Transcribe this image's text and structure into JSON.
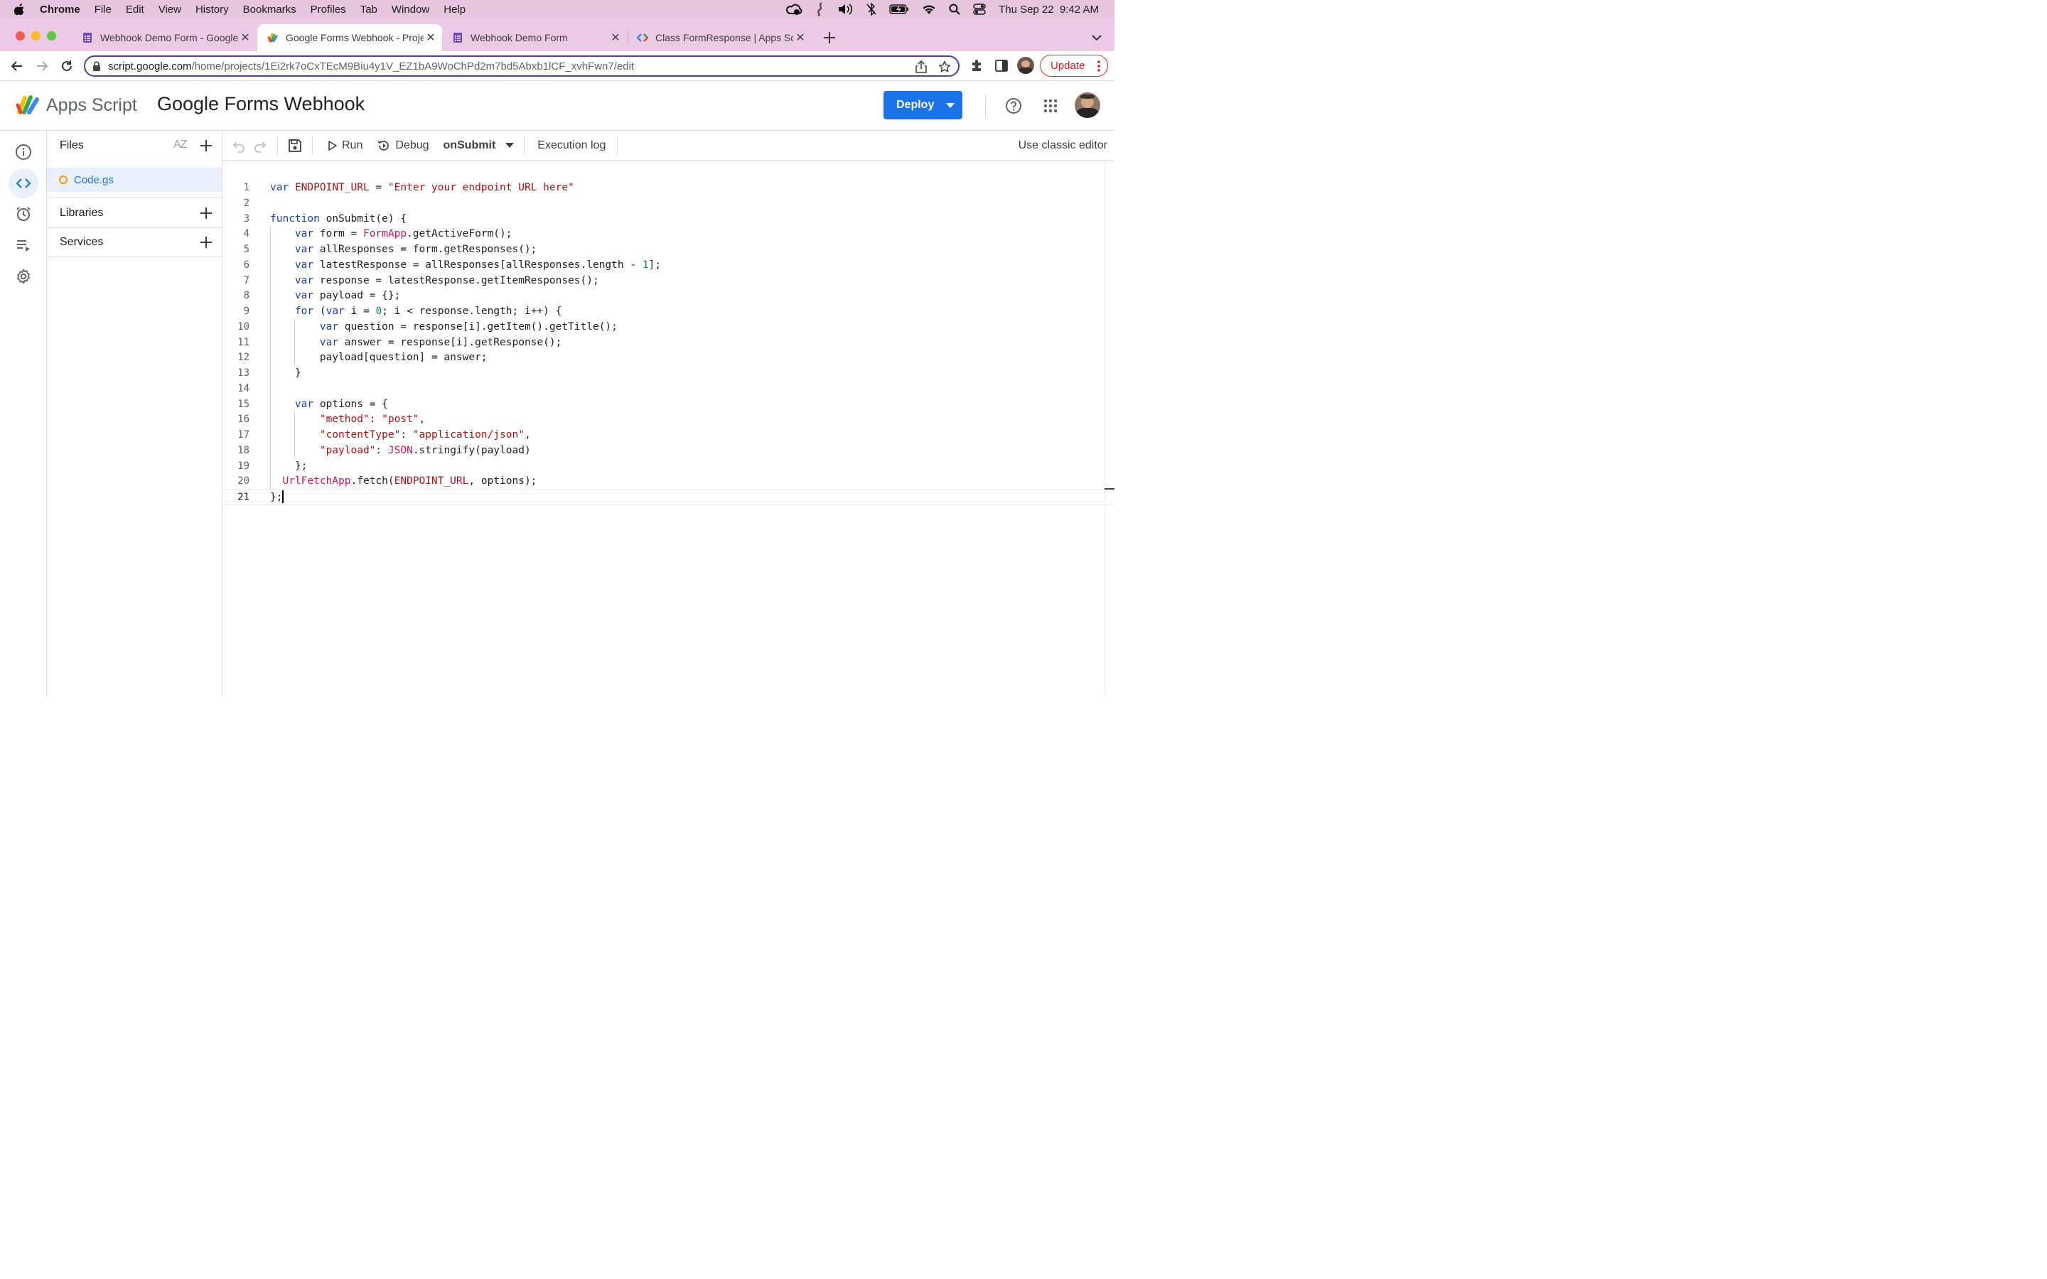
{
  "menubar": {
    "app": "Chrome",
    "items": [
      "File",
      "Edit",
      "View",
      "History",
      "Bookmarks",
      "Profiles",
      "Tab",
      "Window",
      "Help"
    ],
    "clock": "Thu Sep 22  9:42 AM"
  },
  "tabs": [
    {
      "title": "Webhook Demo Form - Google Forms",
      "icon": "google-forms-icon"
    },
    {
      "title": "Google Forms Webhook - Project Editor",
      "icon": "apps-script-icon"
    },
    {
      "title": "Webhook Demo Form",
      "icon": "google-forms-icon"
    },
    {
      "title": "Class FormResponse  |  Apps Script",
      "icon": "google-developers-icon"
    }
  ],
  "address": {
    "host": "script.google.com",
    "path": "/home/projects/1Ei2rk7oCxTEcM9Biu4y1V_EZ1bA9WoChPd2m7bd5Abxb1lCF_xvhFwn7/edit"
  },
  "browser": {
    "update_label": "Update"
  },
  "header": {
    "product": "Apps Script",
    "project_title": "Google Forms Webhook",
    "deploy_label": "Deploy"
  },
  "files_panel": {
    "title": "Files",
    "sort_label": "AZ",
    "file": "Code.gs",
    "libraries": "Libraries",
    "services": "Services"
  },
  "editor_toolbar": {
    "run": "Run",
    "debug": "Debug",
    "function": "onSubmit",
    "execution_log": "Execution log",
    "classic": "Use classic editor"
  },
  "code": {
    "cursor_line": 21,
    "lines": [
      "var ENDPOINT_URL = \"Enter your endpoint URL here\"",
      "",
      "function onSubmit(e) {",
      "    var form = FormApp.getActiveForm();",
      "    var allResponses = form.getResponses();",
      "    var latestResponse = allResponses[allResponses.length - 1];",
      "    var response = latestResponse.getItemResponses();",
      "    var payload = {};",
      "    for (var i = 0; i < response.length; i++) {",
      "        var question = response[i].getItem().getTitle();",
      "        var answer = response[i].getResponse();",
      "        payload[question] = answer;",
      "    }",
      "",
      "    var options = {",
      "        \"method\": \"post\",",
      "        \"contentType\": \"application/json\",",
      "        \"payload\": JSON.stringify(payload)",
      "    };",
      "  UrlFetchApp.fetch(ENDPOINT_URL, options);",
      "};"
    ]
  },
  "colors": {
    "accent": "#1a73e8",
    "menubar": "#e6c5df",
    "tabstrip": "#ecc9e4",
    "keyword": "#1a3fa0",
    "string": "#a31515",
    "builtin": "#c2185b",
    "number": "#098658"
  }
}
